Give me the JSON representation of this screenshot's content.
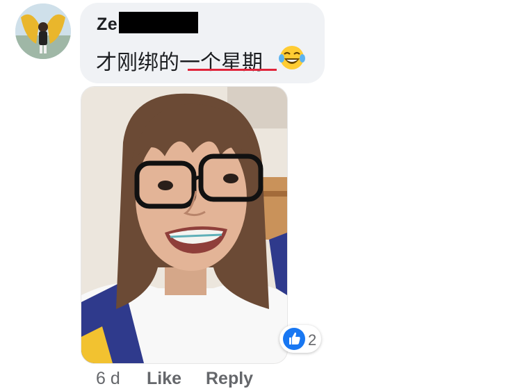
{
  "comment": {
    "author": "Ze",
    "text_before": "才刚绑的",
    "text_underlined": "一个星期",
    "emoji": "laughing-tears-emoji"
  },
  "reactions": {
    "icon": "thumbs-up-icon",
    "count": "2",
    "color": "#1877f2"
  },
  "meta": {
    "time": "6 d",
    "like_label": "Like",
    "reply_label": "Reply"
  },
  "colors": {
    "bubble": "#f0f2f5",
    "underline": "#e0243a",
    "meta_text": "#65676b"
  }
}
